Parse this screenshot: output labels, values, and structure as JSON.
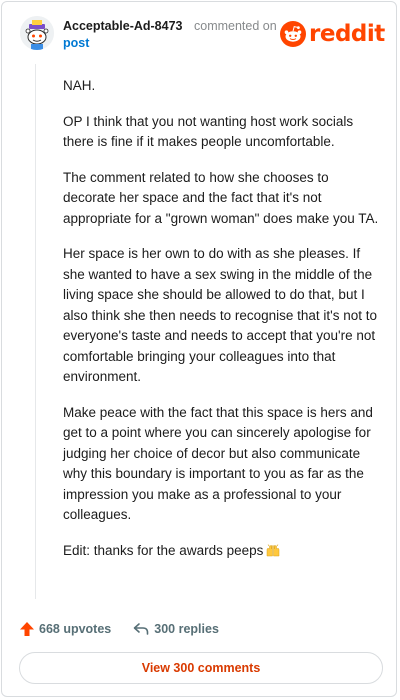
{
  "colors": {
    "brand": "#ff4500",
    "link": "#0079d3",
    "muted": "#878a8c",
    "action_text": "#576f76",
    "view_button_text": "#d93a00"
  },
  "header": {
    "username": "Acceptable-Ad-8473",
    "commented_on": "commented on",
    "post_link": "post",
    "brand_name": "reddit",
    "avatar_icon": "snoo-avatar-icon",
    "brand_icon": "reddit-snoo-icon"
  },
  "comment": {
    "paragraphs": [
      "NAH.",
      "OP I think that you not wanting host work socials there is fine if it makes people uncomfortable.",
      "The comment related to how she chooses to decorate her space and the fact that it's not appropriate for a \"grown woman\" does make you TA.",
      "Her space is her own to do with as she pleases. If she wanted to have a sex swing in the middle of the living space she should be allowed to do that, but I also think she then needs to recognise that it's not to everyone's taste and needs to accept that you're not comfortable bringing your colleagues into that environment.",
      "Make peace with the fact that this space is hers and get to a point where you can sincerely apologise for judging her choice of decor but also communicate why this boundary is important to you as far as the impression you make as a professional to your colleagues."
    ],
    "edit_text": "Edit: thanks for the awards peeps",
    "edit_emoji": "raising-hands-emoji"
  },
  "actions": {
    "upvotes": "668 upvotes",
    "replies": "300 replies",
    "upvote_icon": "upvote-arrow-icon",
    "reply_icon": "reply-arrow-icon"
  },
  "footer": {
    "view_comments": "View 300 comments"
  }
}
